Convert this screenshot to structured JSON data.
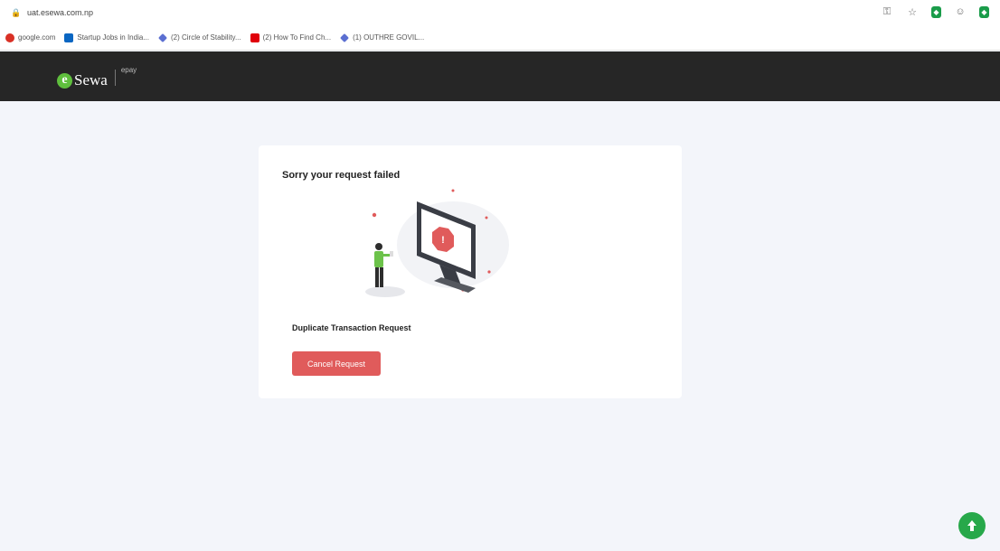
{
  "browser": {
    "url": "uat.esewa.com.np",
    "bookmarks": [
      {
        "label": "google.com",
        "icon": "google-icon",
        "color": "#d93025"
      },
      {
        "label": "Startup Jobs in India...",
        "icon": "linkedin-icon",
        "color": "#0a66c2"
      },
      {
        "label": "(2) Circle of Stability...",
        "icon": "bookmark-icon",
        "color": "#5b6fd1"
      },
      {
        "label": "(2) How To Find Ch...",
        "icon": "youtube-icon",
        "color": "#e0000b"
      },
      {
        "label": "(1) OUTHRE GOVIL...",
        "icon": "bookmark-icon",
        "color": "#5b6fd1"
      }
    ]
  },
  "header": {
    "logo_text": "Sewa",
    "logo_letter": "e",
    "logo_suffix": "epay",
    "brand_color": "#5fbf3d"
  },
  "card": {
    "title": "Sorry your request failed",
    "message": "Duplicate Transaction Request",
    "cancel_label": "Cancel Request",
    "button_color": "#e05b5b"
  },
  "scroll_top": {
    "icon": "arrow-up-icon",
    "color": "#27a84a"
  }
}
